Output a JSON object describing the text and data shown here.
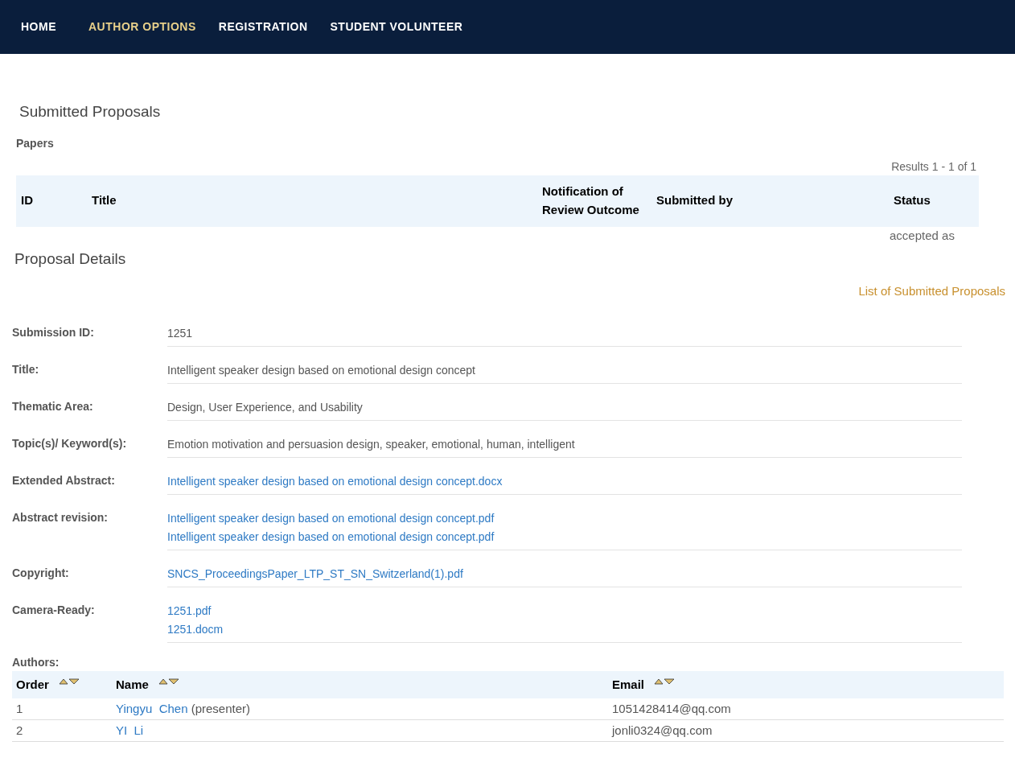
{
  "nav": [
    {
      "label": "HOME",
      "selected": false
    },
    {
      "label": "AUTHOR OPTIONS",
      "selected": true
    },
    {
      "label": "REGISTRATION",
      "selected": false
    },
    {
      "label": "STUDENT VOLUNTEER",
      "selected": false
    }
  ],
  "page_title": "Submitted Proposals",
  "section": "Papers",
  "results": "Results 1 - 1 of 1",
  "papers_table": {
    "columns": [
      "ID",
      "Title",
      "Notification of Review Outcome",
      "Submitted by",
      "Status"
    ],
    "status_text": "accepted as"
  },
  "details_title": "Proposal Details",
  "back_link": "List of Submitted Proposals",
  "details": [
    {
      "label": "Submission ID:",
      "values": [
        {
          "kind": "text",
          "text": "1251"
        }
      ]
    },
    {
      "label": "Title:",
      "values": [
        {
          "kind": "text",
          "text": "Intelligent speaker design based on emotional design concept"
        }
      ]
    },
    {
      "label": "Thematic Area:",
      "values": [
        {
          "kind": "text",
          "text": "Design, User Experience, and Usability"
        }
      ]
    },
    {
      "label": "Topic(s)/ Keyword(s):",
      "values": [
        {
          "kind": "text",
          "text": "Emotion motivation and persuasion design, speaker, emotional, human, intelligent"
        }
      ]
    },
    {
      "label": "Extended Abstract:",
      "values": [
        {
          "kind": "link",
          "text": "Intelligent speaker design based on emotional design concept.docx"
        }
      ]
    },
    {
      "label": "Abstract revision:",
      "values": [
        {
          "kind": "link",
          "text": "Intelligent speaker design based on emotional design concept.pdf"
        },
        {
          "kind": "link",
          "text": "Intelligent speaker design based on emotional design concept.pdf"
        }
      ]
    },
    {
      "label": "Copyright:",
      "values": [
        {
          "kind": "link",
          "text": "SNCS_ProceedingsPaper_LTP_ST_SN_Switzerland(1).pdf"
        }
      ]
    },
    {
      "label": "Camera-Ready:",
      "values": [
        {
          "kind": "link",
          "text": "1251.pdf"
        },
        {
          "kind": "link",
          "text": "1251.docm"
        }
      ]
    }
  ],
  "authors_label": "Authors:",
  "authors": {
    "columns": [
      "Order",
      "Name",
      "Email"
    ],
    "rows": [
      {
        "order": "1",
        "name": "Yingyu  Chen",
        "note": "(presenter)",
        "email": "1051428414@qq.com"
      },
      {
        "order": "2",
        "name": "YI  Li",
        "email": "jonli0324@qq.com"
      }
    ]
  }
}
